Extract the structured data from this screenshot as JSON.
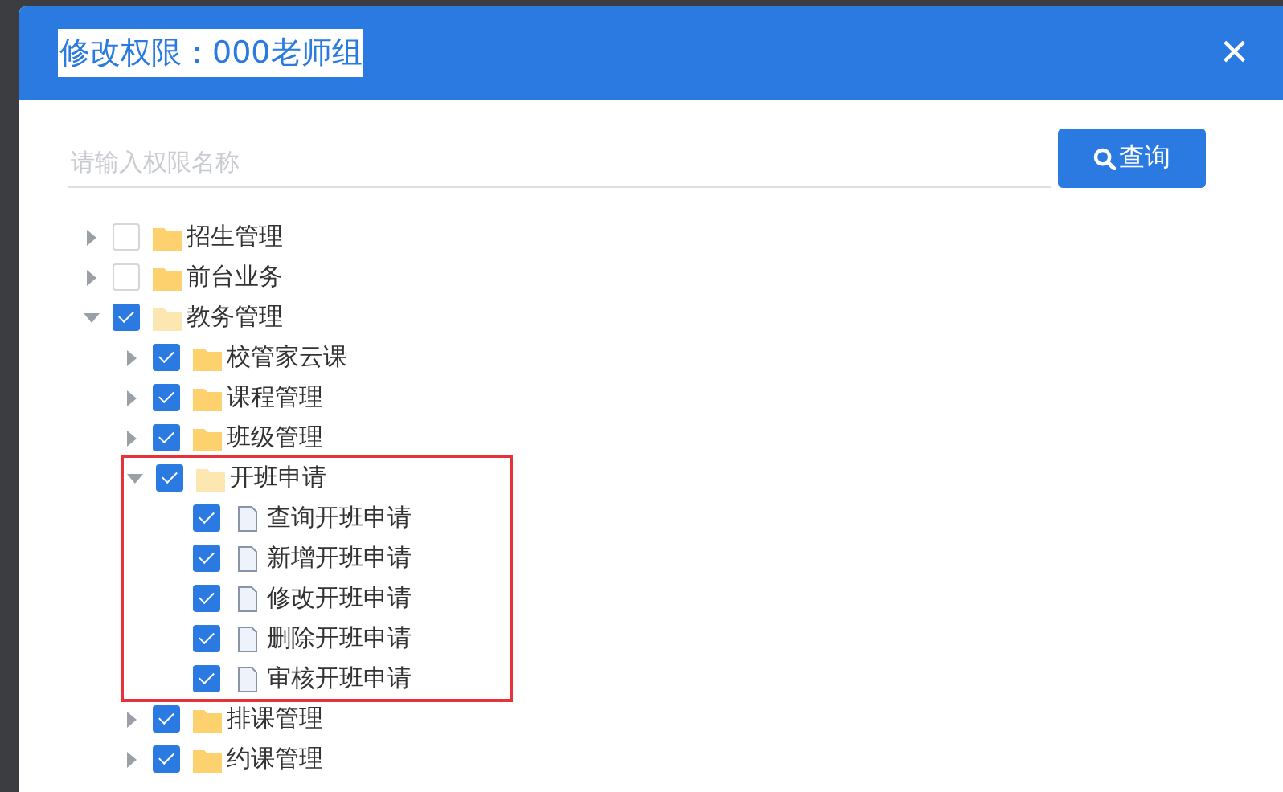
{
  "dialog": {
    "title": "修改权限：000老师组",
    "title_selected": true,
    "close": "×"
  },
  "search": {
    "placeholder": "请输入权限名称",
    "button": "查询"
  },
  "tree": [
    {
      "label": "招生管理",
      "kind": "folder",
      "checked": false,
      "expanded": false
    },
    {
      "label": "前台业务",
      "kind": "folder",
      "checked": false,
      "expanded": false
    },
    {
      "label": "教务管理",
      "kind": "folder",
      "checked": true,
      "expanded": true,
      "children": [
        {
          "label": "校管家云课",
          "kind": "folder",
          "checked": true,
          "expanded": false
        },
        {
          "label": "课程管理",
          "kind": "folder",
          "checked": true,
          "expanded": false
        },
        {
          "label": "班级管理",
          "kind": "folder",
          "checked": true,
          "expanded": false
        },
        {
          "label": "开班申请",
          "kind": "folder",
          "checked": true,
          "expanded": true,
          "highlighted": true,
          "children": [
            {
              "label": "查询开班申请",
              "kind": "file",
              "checked": true
            },
            {
              "label": "新增开班申请",
              "kind": "file",
              "checked": true
            },
            {
              "label": "修改开班申请",
              "kind": "file",
              "checked": true
            },
            {
              "label": "删除开班申请",
              "kind": "file",
              "checked": true
            },
            {
              "label": "审核开班申请",
              "kind": "file",
              "checked": true
            }
          ]
        },
        {
          "label": "排课管理",
          "kind": "folder",
          "checked": true,
          "expanded": false
        },
        {
          "label": "约课管理",
          "kind": "folder",
          "checked": true,
          "expanded": false
        }
      ]
    }
  ]
}
